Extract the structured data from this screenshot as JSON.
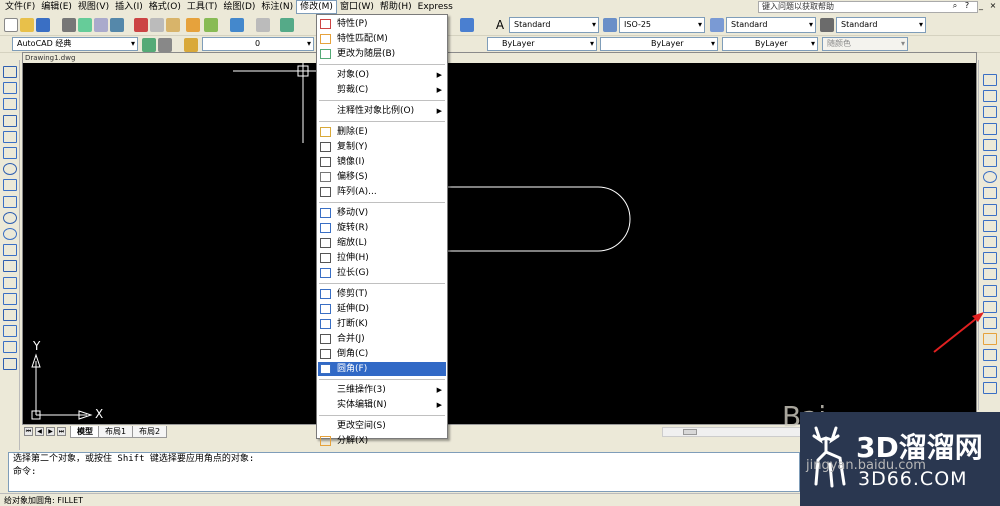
{
  "menu_bar": {
    "items": [
      "文件(F)",
      "编辑(E)",
      "视图(V)",
      "插入(I)",
      "格式(O)",
      "工具(T)",
      "绘图(D)",
      "标注(N)",
      "修改(M)",
      "窗口(W)",
      "帮助(H)",
      "Express"
    ],
    "active_index": 8,
    "help_search_placeholder": "键入问题以获取帮助"
  },
  "styles_toolbar": {
    "text_style": "Standard",
    "dim_style": "ISO-25",
    "table_style": "Standard",
    "multileader_style": "Standard"
  },
  "workspace_toolbar": {
    "workspace": "AutoCAD 经典",
    "layer": "0",
    "color": "ByLayer",
    "linetype": "ByLayer",
    "lineweight": "ByLayer",
    "plot_style": "随颜色"
  },
  "drawing": {
    "title": "Drawing1.dwg",
    "ucs_y_label": "Y",
    "ucs_x_label": "X"
  },
  "layout_tabs": [
    "模型",
    "布局1",
    "布局2"
  ],
  "modify_menu": {
    "groups": [
      [
        {
          "label": "特性(P)",
          "icon": "properties-icon"
        },
        {
          "label": "特性匹配(M)",
          "icon": "match-properties-icon"
        },
        {
          "label": "更改为随层(B)",
          "icon": "bylayer-icon"
        }
      ],
      [
        {
          "label": "对象(O)",
          "submenu": true
        },
        {
          "label": "剪裁(C)",
          "submenu": true
        }
      ],
      [
        {
          "label": "注释性对象比例(O)",
          "submenu": true
        }
      ],
      [
        {
          "label": "删除(E)",
          "icon": "erase-icon"
        },
        {
          "label": "复制(Y)",
          "icon": "copy-icon"
        },
        {
          "label": "镜像(I)",
          "icon": "mirror-icon"
        },
        {
          "label": "偏移(S)",
          "icon": "offset-icon"
        },
        {
          "label": "阵列(A)...",
          "icon": "array-icon"
        }
      ],
      [
        {
          "label": "移动(V)",
          "icon": "move-icon"
        },
        {
          "label": "旋转(R)",
          "icon": "rotate-icon"
        },
        {
          "label": "缩放(L)",
          "icon": "scale-icon"
        },
        {
          "label": "拉伸(H)",
          "icon": "stretch-icon"
        },
        {
          "label": "拉长(G)",
          "icon": "lengthen-icon"
        }
      ],
      [
        {
          "label": "修剪(T)",
          "icon": "trim-icon"
        },
        {
          "label": "延伸(D)",
          "icon": "extend-icon"
        },
        {
          "label": "打断(K)",
          "icon": "break-icon"
        },
        {
          "label": "合并(J)",
          "icon": "join-icon"
        },
        {
          "label": "倒角(C)",
          "icon": "chamfer-icon"
        },
        {
          "label": "圆角(F)",
          "icon": "fillet-icon",
          "highlighted": true
        }
      ],
      [
        {
          "label": "三维操作(3)",
          "submenu": true
        },
        {
          "label": "实体编辑(N)",
          "submenu": true
        }
      ],
      [
        {
          "label": "更改空间(S)"
        },
        {
          "label": "分解(X)",
          "icon": "explode-icon"
        }
      ]
    ]
  },
  "command_line": {
    "line1": "选择第二个对象，或按住 Shift 键选择要应用角点的对象:",
    "line2": "命令:"
  },
  "status_bar": {
    "text": "给对象加圆角:   FILLET"
  },
  "watermark": {
    "title": "3D溜溜网",
    "url": "3D66.COM",
    "ghost_text": "Bai",
    "ghost_url": "jingyan.baidu.com"
  },
  "colors": {
    "menu_highlight": "#3169c6",
    "canvas_bg": "#000000",
    "arrow_red": "#e02020",
    "watermark_bg": "#2a3750"
  }
}
